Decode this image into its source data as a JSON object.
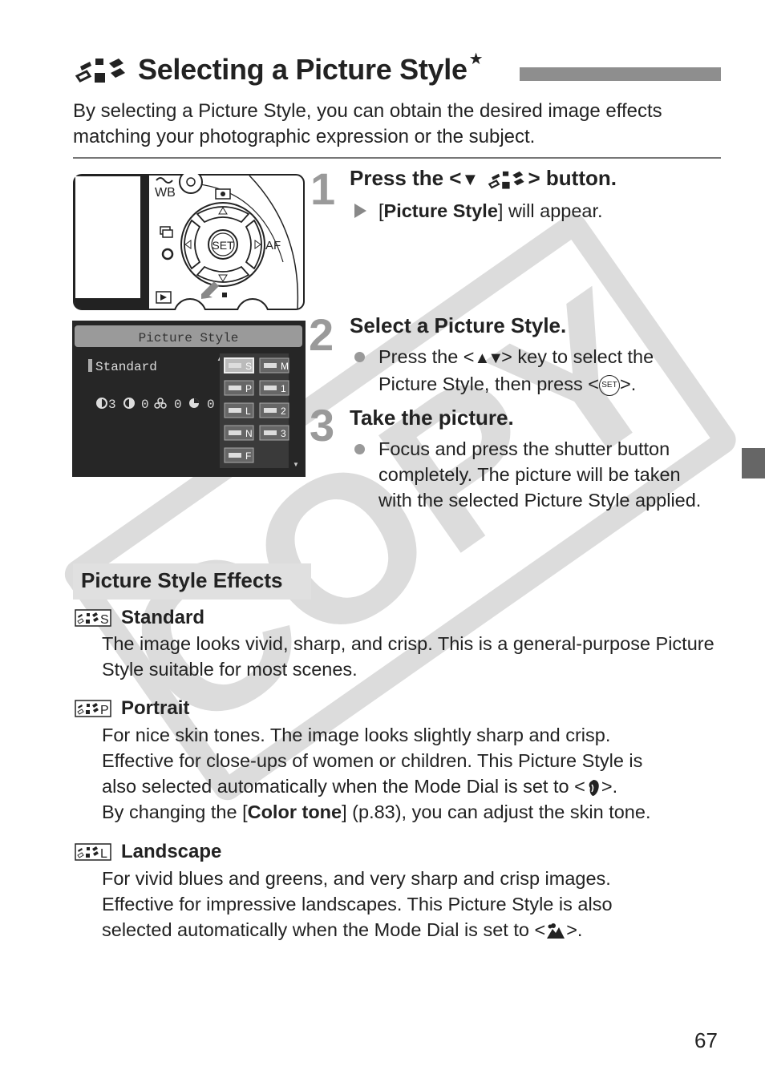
{
  "header": {
    "title": "Selecting a Picture Style",
    "title_icon": "picture-style-icon",
    "title_suffix": "★",
    "intro": "By selecting a Picture Style, you can obtain the desired image effects matching your photographic expression or the subject."
  },
  "camera_image": {
    "labels": {
      "wb": "WB",
      "af": "AF",
      "set": "SET"
    }
  },
  "lcd_screen": {
    "title": "Picture Style",
    "selected_style": "Standard",
    "settings_readout": [
      "3",
      "0",
      "0",
      "0"
    ],
    "styles": [
      "S",
      "M",
      "P",
      "1",
      "L",
      "2",
      "N",
      "3",
      "F"
    ],
    "selected_index": 0
  },
  "steps": [
    {
      "number": "1",
      "title_before": "Press the <",
      "title_icons": "down-arrow + picture-style-icon",
      "title_after": "> button.",
      "body_bold": "Picture Style",
      "body_prefix": "[",
      "body_suffix": "] will appear."
    },
    {
      "number": "2",
      "title": "Select a Picture Style.",
      "body_line1_before": "Press the <",
      "body_line1_after": "> key to select the",
      "body_line2_before": "Picture Style, then press <",
      "body_line2_after": ">."
    },
    {
      "number": "3",
      "title": "Take the picture.",
      "body": "Focus and press the shutter button completely. The picture will be taken with the selected Picture Style applied."
    }
  ],
  "effects": {
    "heading": "Picture Style Effects",
    "items": [
      {
        "icon_letter": "S",
        "name": "Standard",
        "description": "The image looks vivid, sharp, and crisp. This is a general-purpose Picture Style suitable for most scenes."
      },
      {
        "icon_letter": "P",
        "name": "Portrait",
        "line1": "For nice skin tones. The image looks slightly sharp and crisp.",
        "line2": "Effective for close-ups of women or children. This Picture Style is",
        "line3_before": "also selected automatically when the Mode Dial is set to <",
        "line3_after": ">.",
        "line4_before": "By changing the [",
        "line4_bold": "Color tone",
        "line4_after": "] (p.83), you can adjust the skin tone."
      },
      {
        "icon_letter": "L",
        "name": "Landscape",
        "line1": "For vivid blues and greens, and very sharp and crisp images.",
        "line2": "Effective for impressive landscapes. This Picture Style is also",
        "line3_before": "selected automatically when the Mode Dial is set to <",
        "line3_after": ">."
      }
    ]
  },
  "watermark": "COPY",
  "page_number": "67",
  "colors": {
    "text": "#222222",
    "step_number": "#9a9a9a",
    "title_bar": "#8e8e8e",
    "heading_bg": "#e0e0e0",
    "side_tab": "#666666",
    "watermark": "#d9d9d9"
  }
}
